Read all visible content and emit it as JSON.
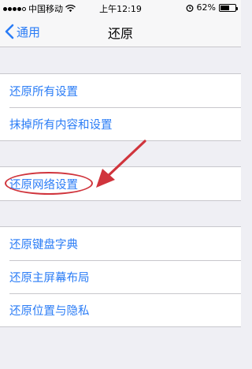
{
  "status_bar": {
    "carrier": "中国移动",
    "time": "上午12:19",
    "battery_percent": "62%",
    "battery_level": 0.62
  },
  "nav": {
    "back_label": "通用",
    "title": "还原"
  },
  "groups": [
    {
      "items": [
        "还原所有设置",
        "抹掉所有内容和设置"
      ]
    },
    {
      "items": [
        "还原网络设置"
      ]
    },
    {
      "items": [
        "还原键盘字典",
        "还原主屏幕布局",
        "还原位置与隐私"
      ]
    }
  ],
  "annotation": {
    "highlight_color": "#d0343c",
    "target": "还原网络设置"
  },
  "colors": {
    "accent": "#2a7cf6",
    "background": "#efeff4",
    "separator": "#c8c7cc"
  }
}
